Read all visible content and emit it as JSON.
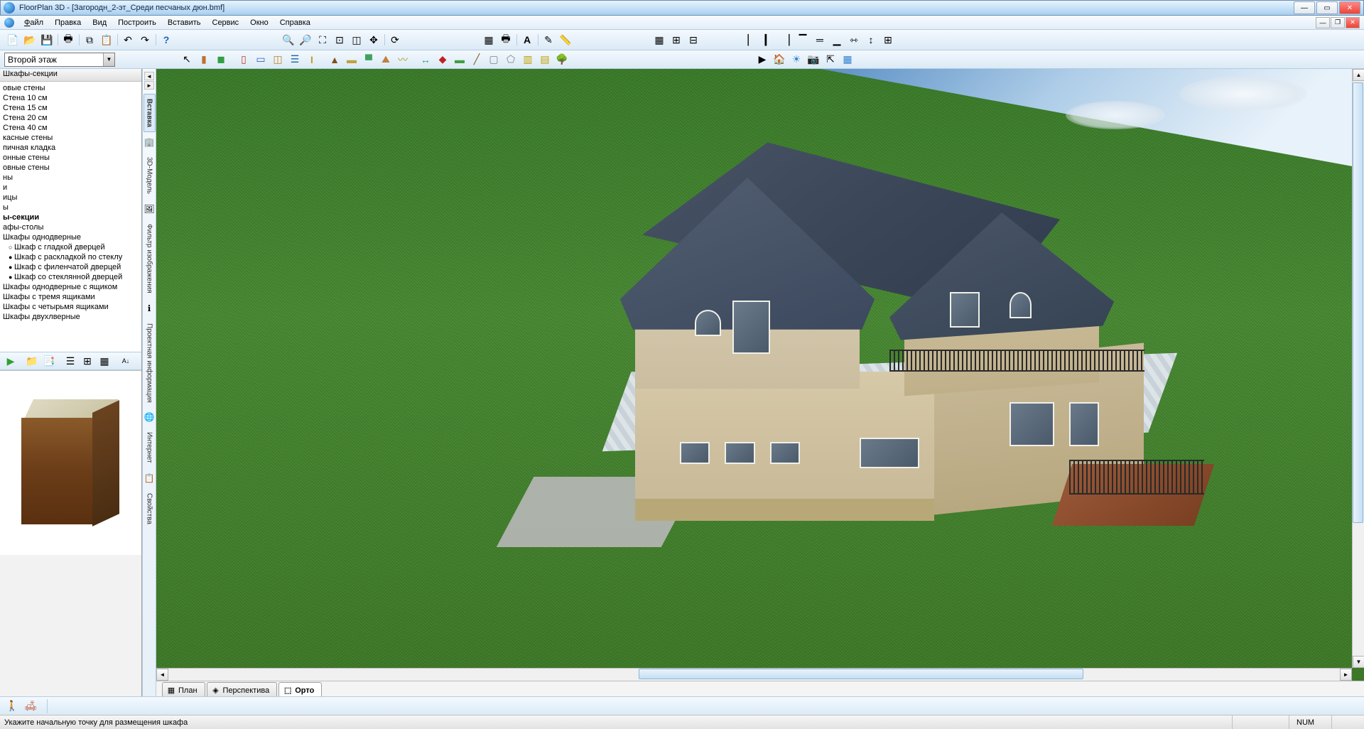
{
  "title": "FloorPlan 3D - [Загородн_2-эт_Среди песчаных дюн.bmf]",
  "menu": {
    "file": "Файл",
    "edit": "Правка",
    "view": "Вид",
    "build": "Построить",
    "insert": "Вставить",
    "service": "Сервис",
    "window": "Окно",
    "help": "Справка"
  },
  "floor_select": "Второй этаж",
  "panel": {
    "title": "Шкафы-секции",
    "items": [
      {
        "label": "овые стены",
        "bold": false
      },
      {
        "label": "Стена 10 см",
        "bold": false
      },
      {
        "label": "Стена 15 см",
        "bold": false
      },
      {
        "label": "Стена 20 см",
        "bold": false
      },
      {
        "label": "Стена 40 см",
        "bold": false
      },
      {
        "label": "касные стены",
        "bold": false
      },
      {
        "label": "пичная кладка",
        "bold": false
      },
      {
        "label": "онные стены",
        "bold": false
      },
      {
        "label": "овные стены",
        "bold": false
      },
      {
        "label": "ны",
        "bold": false
      },
      {
        "label": "и",
        "bold": false
      },
      {
        "label": "ицы",
        "bold": false
      },
      {
        "label": "ы",
        "bold": false
      },
      {
        "label": "ы-секции",
        "bold": true
      },
      {
        "label": "афы-столы",
        "bold": false
      },
      {
        "label": "Шкафы однодверные",
        "bold": false
      },
      {
        "label": "Шкаф с гладкой дверцей",
        "bold": false,
        "sub": true
      },
      {
        "label": "Шкаф с раскладкой по стеклу",
        "bold": false,
        "sub": true,
        "filled": true
      },
      {
        "label": "Шкаф с филенчатой дверцей",
        "bold": false,
        "sub": true,
        "filled": true
      },
      {
        "label": "Шкаф со стеклянной дверцей",
        "bold": false,
        "sub": true,
        "filled": true
      },
      {
        "label": "Шкафы однодверные с ящиком",
        "bold": false
      },
      {
        "label": "Шкафы с тремя ящиками",
        "bold": false
      },
      {
        "label": "Шкафы с четырьмя ящиками",
        "bold": false
      },
      {
        "label": "Шкафы двухлверные",
        "bold": false
      }
    ]
  },
  "side_tabs": {
    "insert": "Вставка",
    "model3d": "3D-Модель",
    "image_filter": "Фильтр изображения",
    "project_info": "Проектная информация",
    "internet": "Интернет",
    "properties": "Свойства"
  },
  "view_tabs": {
    "plan": "План",
    "perspective": "Перспектива",
    "ortho": "Орто"
  },
  "status": {
    "hint": "Укажите начальную точку для размещения шкафа",
    "num": "NUM"
  },
  "colors": {
    "accent": "#3a7a2a",
    "toolbar": "#dbeaf6"
  }
}
